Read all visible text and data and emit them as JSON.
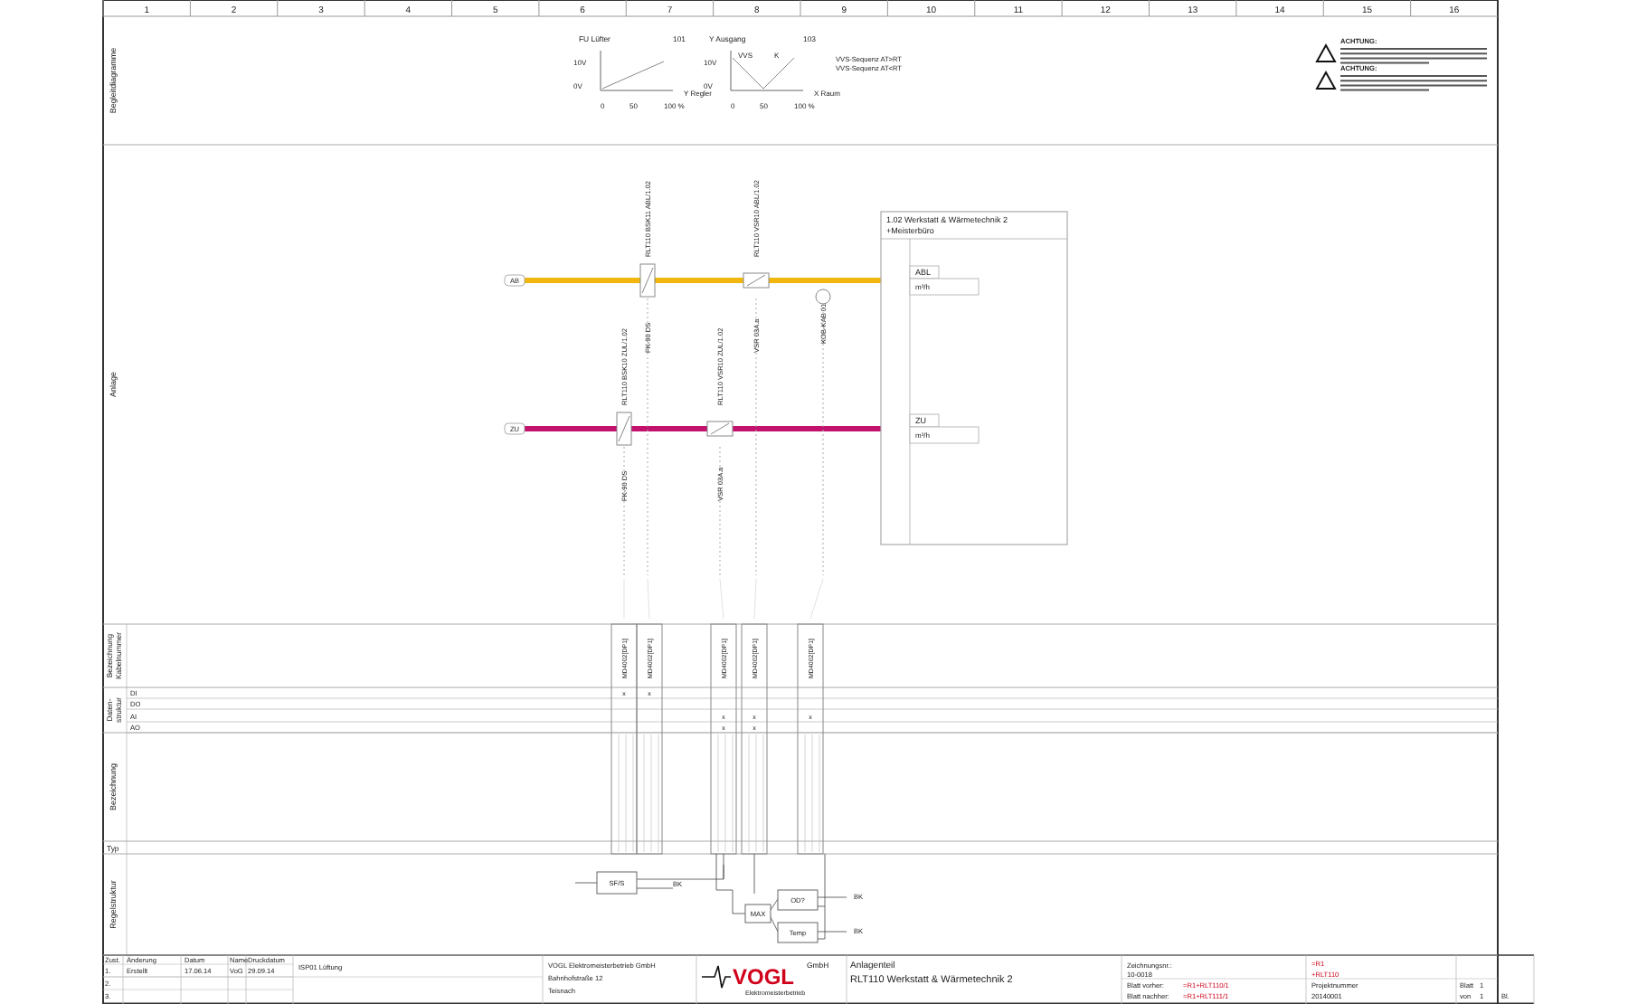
{
  "column_numbers": [
    "1",
    "2",
    "3",
    "4",
    "5",
    "6",
    "7",
    "8",
    "9",
    "10",
    "11",
    "12",
    "13",
    "14",
    "15",
    "16"
  ],
  "row_labels": [
    {
      "kind": "single",
      "label": "Begleitdiagramme"
    },
    {
      "kind": "single",
      "label": "Anlage"
    },
    {
      "kind": "double",
      "label": "Bezeichnung",
      "label_2": "Kabelnummer"
    },
    {
      "kind": "double",
      "label": "Daten-",
      "label_2": "struktur"
    },
    {
      "kind": "single",
      "label": "Bezeichnung"
    },
    {
      "kind": "flat",
      "label": "Typ"
    },
    {
      "kind": "single",
      "label": "Regelstruktur"
    }
  ],
  "data_structure_rows": [
    "DI",
    "DO",
    "AI",
    "AO"
  ],
  "diagrams": [
    {
      "kind": "ramp",
      "title": "FU Lüfter",
      "ref": "101",
      "y_labels": [
        "10V",
        "0V"
      ],
      "x_label": "Y Regler",
      "x_ticks": [
        "0",
        "50",
        "100 %"
      ]
    },
    {
      "kind": "vee",
      "title": "Y Ausgang",
      "ref": "103",
      "y_labels": [
        "10V",
        "0V"
      ],
      "x_label": "X Raum",
      "x_ticks": [
        "0",
        "50",
        "100 %"
      ],
      "curve_labels": [
        "VVS",
        "K"
      ],
      "legend": [
        "VVS-Sequenz AT>RT",
        "VVS-Sequenz AT<RT"
      ]
    }
  ],
  "warnings": [
    {
      "heading": "ACHTUNG:"
    },
    {
      "heading": "ACHTUNG:"
    }
  ],
  "ducts": [
    {
      "label": "AB",
      "color": "#f2b70f",
      "components": [
        {
          "kind": "fire_damper",
          "tag": "RLT110 BSK11 ABL/1.02",
          "type": "FK-90 DS"
        },
        {
          "kind": "vav_box",
          "tag": "RLT110 VSR10 ABL/1.02",
          "type": "VSR 03A.a"
        },
        {
          "kind": "sensor",
          "type": "KOB-KAB 01"
        }
      ]
    },
    {
      "label": "ZU",
      "color": "#c3126e",
      "components": [
        {
          "kind": "fire_damper",
          "tag": "RLT110 BSK10 ZUL/1.02",
          "type": "FK-90 DS"
        },
        {
          "kind": "vav_box",
          "tag": "RLT110 VSR10 ZUL/1.02",
          "type": "VSR 03A.a"
        }
      ]
    }
  ],
  "room": {
    "title": "1.02 Werkstatt & Wärmetechnik 2",
    "subtitle": "+Meisterbüro",
    "ports": [
      {
        "label": "ABL",
        "unit": "m³/h"
      },
      {
        "label": "ZU",
        "unit": "m³/h"
      }
    ]
  },
  "io_columns": [
    {
      "module": "MD4002[DP1]",
      "di": "x"
    },
    {
      "module": "MD4002[DP1]",
      "di": "x"
    },
    {
      "module": "MD4002[DP1]",
      "ai": "x",
      "ao": "x"
    },
    {
      "module": "MD4002[DP1]",
      "ai": "x",
      "ao": "x"
    },
    {
      "module": "MD4002[DP1]",
      "ai": "x"
    }
  ],
  "control_blocks": [
    {
      "label": "SF/S",
      "output": "BK"
    },
    {
      "label": "MAX"
    },
    {
      "label": "OD?",
      "output": "BK"
    },
    {
      "label": "Temp",
      "output": "BK"
    }
  ],
  "title_block": {
    "headers": [
      "Zust.",
      "Änderung",
      "Datum",
      "Name",
      "Druckdatum"
    ],
    "revisions": [
      {
        "state": "1.",
        "change": "Erstellt",
        "date": "17.06.14",
        "name": "VoG",
        "print_date": "29.09.14"
      },
      {
        "state": "2."
      },
      {
        "state": "3."
      }
    ],
    "project": "ISP01 Lüftung",
    "company": [
      "VOGL Elektromeisterbetrieb GmbH",
      "Bahnhofstraße 12",
      "Teisnach"
    ],
    "logo": {
      "name": "VOGL",
      "suffix": "GmbH",
      "caption": "Elektromeisterbetrieb"
    },
    "section_label": "Anlagenteil",
    "section": "RLT110 Werkstatt & Wärmetechnik 2",
    "drawing_no_label": "Zeichnungsnr.:",
    "drawing_no": "10-0018",
    "prev_label": "Blatt vorher:",
    "prev": "=R1+RLT110/1",
    "next_label": "Blatt nachher:",
    "next": "=R1+RLT111/1",
    "plant": "=R1",
    "location": "+RLT110",
    "project_no_label": "Projektnummer",
    "project_no": "20140001",
    "sheet_label": "Blatt",
    "sheet": "1",
    "of_label": "von",
    "of": "1",
    "bl": "Bl."
  }
}
